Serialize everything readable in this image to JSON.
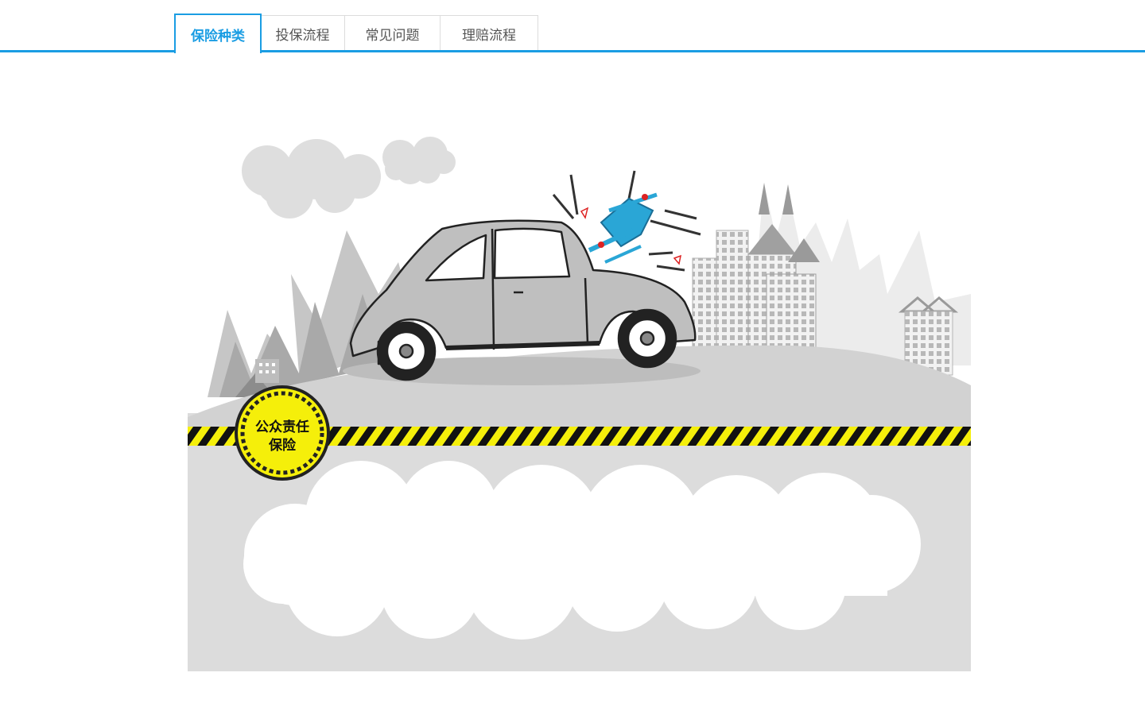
{
  "tabs": [
    {
      "label": "保险种类",
      "active": true
    },
    {
      "label": "投保流程",
      "active": false
    },
    {
      "label": "常见问题",
      "active": false
    },
    {
      "label": "理赔流程",
      "active": false
    }
  ],
  "colors": {
    "accent": "#1a9de3",
    "hazard_yellow": "#f5ef0a",
    "road_gray": "#dcdcdc",
    "drone_blue": "#2aa6d6"
  },
  "banner": {
    "badge_line1": "公众责任",
    "badge_line2": "保险"
  }
}
